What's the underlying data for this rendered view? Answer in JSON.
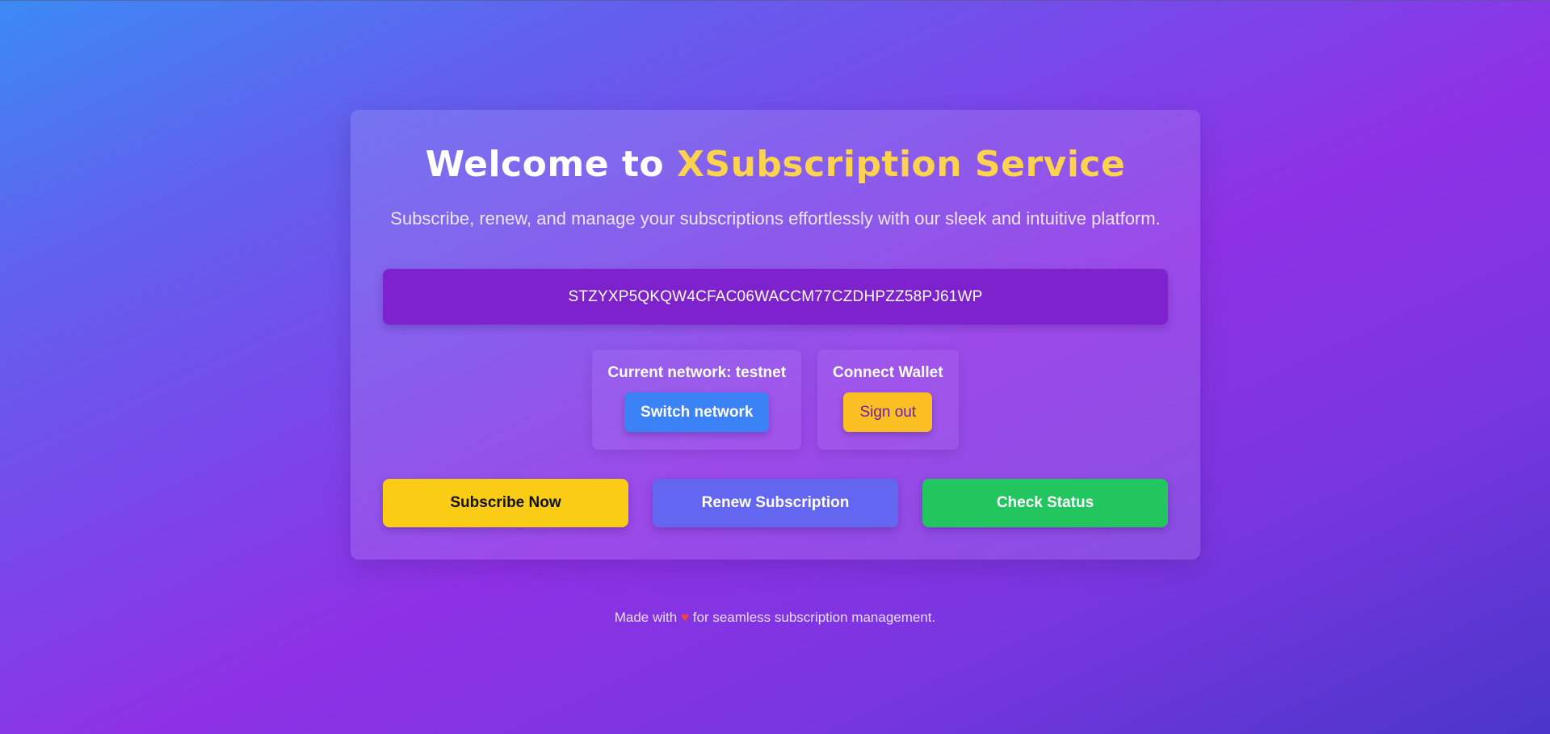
{
  "header": {
    "title_prefix": "Welcome to ",
    "title_brand": "XSubscription Service",
    "subtitle": "Subscribe, renew, and manage your subscriptions effortlessly with our sleek and intuitive platform."
  },
  "wallet": {
    "address": "STZYXP5QKQW4CFAC06WACCM77CZDHPZZ58PJ61WP"
  },
  "network_panel": {
    "label": "Current network: testnet",
    "button_label": "Switch network"
  },
  "wallet_panel": {
    "label": "Connect Wallet",
    "button_label": "Sign out"
  },
  "actions": {
    "subscribe_label": "Subscribe Now",
    "renew_label": "Renew Subscription",
    "status_label": "Check Status"
  },
  "footer": {
    "prefix": "Made with",
    "heart": "♥",
    "suffix": "for seamless subscription management."
  },
  "colors": {
    "brand_accent": "#fcd34d",
    "subscribe": "#facc15",
    "renew": "#6366f1",
    "status": "#22c55e",
    "switch_network": "#3b82f6",
    "sign_out": "#fbbf24",
    "address_box": "#7e22ce"
  }
}
